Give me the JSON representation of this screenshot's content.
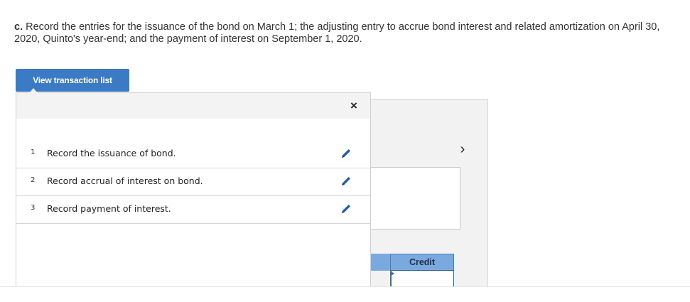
{
  "question": {
    "label": "c.",
    "text": " Record the entries for the issuance of the bond on March 1; the adjusting entry to accrue bond interest and related amortization on April 30, 2020, Quinto's year-end; and the payment of interest on September 1, 2020."
  },
  "view_transaction_button": {
    "label": "View transaction list"
  },
  "popup": {
    "close_icon": "×",
    "transactions": [
      {
        "num": "1",
        "label": "Record the issuance of bond."
      },
      {
        "num": "2",
        "label": "Record accrual of interest on bond."
      },
      {
        "num": "3",
        "label": "Record payment of interest."
      }
    ]
  },
  "journal": {
    "next_icon": "›",
    "credit_header": "Credit"
  },
  "colors": {
    "button_blue": "#3b7bc6",
    "header_blue": "#7aa9e0",
    "edit_icon_blue": "#1d5fb5"
  }
}
